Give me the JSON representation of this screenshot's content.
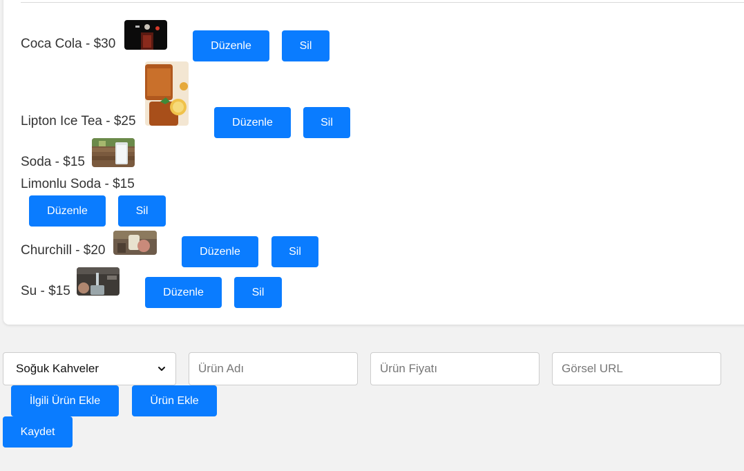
{
  "products": [
    {
      "label": "Coca Cola - $30",
      "has_image": true,
      "edit_label": "Düzenle",
      "delete_label": "Sil"
    },
    {
      "label": "Lipton Ice Tea - $25",
      "has_image": true,
      "edit_label": "Düzenle",
      "delete_label": "Sil"
    },
    {
      "label": "Soda - $15",
      "has_image": true
    },
    {
      "label": "Limonlu Soda - $15",
      "has_image": false,
      "edit_label": "Düzenle",
      "delete_label": "Sil"
    },
    {
      "label": "Churchill - $20",
      "has_image": true,
      "edit_label": "Düzenle",
      "delete_label": "Sil"
    },
    {
      "label": "Su - $15",
      "has_image": true,
      "edit_label": "Düzenle",
      "delete_label": "Sil"
    }
  ],
  "form": {
    "category_select": {
      "selected": "Soğuk Kahveler"
    },
    "name_placeholder": "Ürün Adı",
    "price_placeholder": "Ürün Fiyatı",
    "image_url_placeholder": "Görsel URL",
    "add_related_label": "İlgili Ürün Ekle",
    "add_product_label": "Ürün Ekle",
    "save_label": "Kaydet"
  },
  "colors": {
    "button_blue": "#0a7cff",
    "page_background": "#f2f2f2",
    "card_background": "#ffffff"
  },
  "icons": {
    "select_arrow": "chevron-down-icon"
  }
}
